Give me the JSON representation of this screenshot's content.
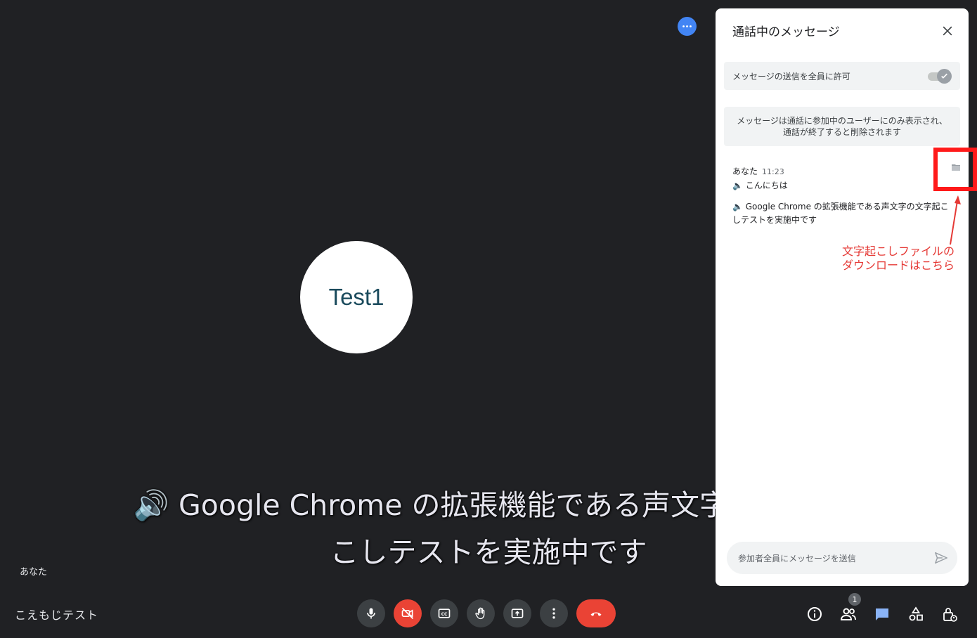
{
  "stage": {
    "participant_tile": "Test1",
    "self_label": "あなた",
    "meeting_name": "こえもじテスト",
    "caption_line1": "🔊 Google Chrome の拡張機能である声文字の文字起",
    "caption_line2": "こしテストを実施中です"
  },
  "controls": [
    {
      "name": "mic",
      "icon": "mic-icon"
    },
    {
      "name": "camera-off",
      "icon": "videocam-off-icon",
      "color": "#ea4335"
    },
    {
      "name": "captions",
      "icon": "cc-icon"
    },
    {
      "name": "raise-hand",
      "icon": "hand-icon"
    },
    {
      "name": "present",
      "icon": "present-icon"
    },
    {
      "name": "more",
      "icon": "more-vert-icon"
    },
    {
      "name": "hang-up",
      "icon": "call-end-icon",
      "color": "#ea4335"
    }
  ],
  "right_controls": {
    "participants_count": "1"
  },
  "panel": {
    "title": "通話中のメッセージ",
    "allow_label": "メッセージの送信を全員に許可",
    "info_text_line1": "メッセージは通話に参加中のユーザーにのみ表示され、",
    "info_text_line2": "通話が終了すると削除されます",
    "message": {
      "sender": "あなた",
      "time": "11:23",
      "line1": "🔈 こんにちは",
      "line2": "🔈 Google Chrome の拡張機能である声文字の文字起こしテストを実施中です"
    },
    "input_placeholder": "参加者全員にメッセージを送信"
  },
  "annotation": {
    "line1": "文字起こしファイルの",
    "line2": "ダウンロードはこちら",
    "color": "#e53935"
  },
  "colors": {
    "background": "#202124",
    "accent": "#4285f4",
    "danger": "#ea4335"
  }
}
